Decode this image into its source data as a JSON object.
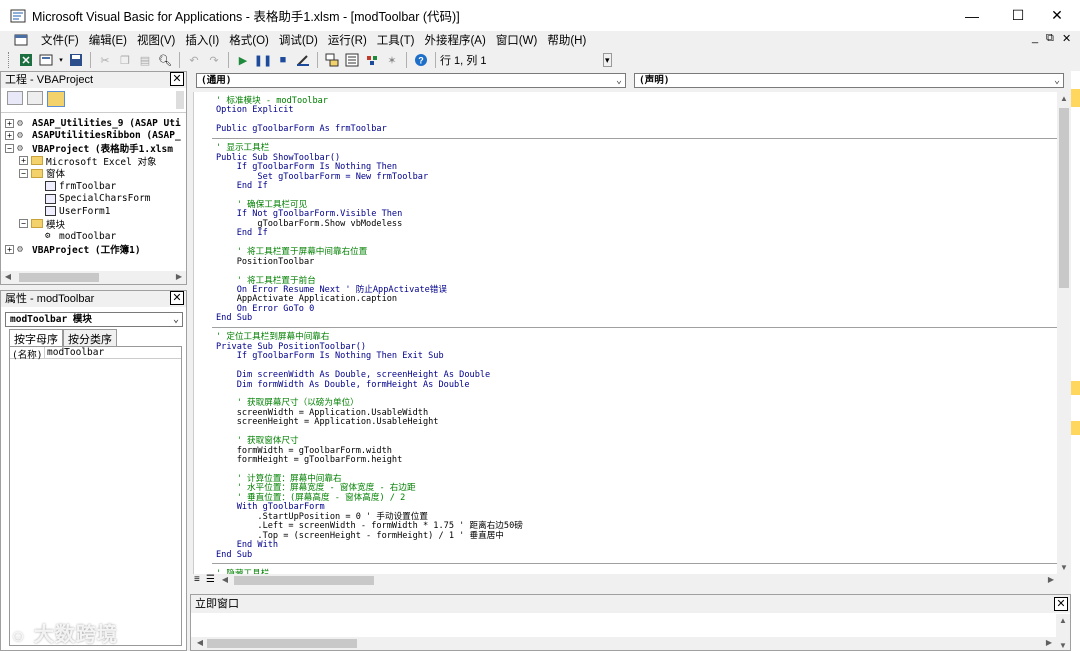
{
  "window": {
    "title": "Microsoft Visual Basic for Applications - 表格助手1.xlsm - [modToolbar (代码)]",
    "minimize": "—",
    "maximize": "☐",
    "close": "✕"
  },
  "menu": {
    "items": [
      "文件(F)",
      "编辑(E)",
      "视图(V)",
      "插入(I)",
      "格式(O)",
      "调试(D)",
      "运行(R)",
      "工具(T)",
      "外接程序(A)",
      "窗口(W)",
      "帮助(H)"
    ],
    "mdi_minimize": "_",
    "mdi_restore": "⧉",
    "mdi_close": "✕"
  },
  "toolbar": {
    "position_text": "行 1, 列 1",
    "icons": [
      "excel-icon",
      "insert-module-icon",
      "save-icon",
      "cut-icon",
      "copy-icon",
      "paste-icon",
      "find-icon",
      "undo-icon",
      "redo-icon",
      "run-icon",
      "break-icon",
      "reset-icon",
      "design-mode-icon",
      "project-explorer-icon",
      "properties-icon",
      "object-browser-icon",
      "toolbox-icon",
      "help-icon"
    ]
  },
  "project": {
    "header": "工程 - VBAProject",
    "close": "✕",
    "tree": [
      {
        "exp": "+",
        "icon": "vbp",
        "text": "ASAP_Utilities_9 (ASAP Uti",
        "bold": true,
        "indent": 0
      },
      {
        "exp": "+",
        "icon": "vbp",
        "text": "ASAPUtilitiesRibbon (ASAP_",
        "bold": true,
        "indent": 0
      },
      {
        "exp": "−",
        "icon": "vbp",
        "text": "VBAProject (表格助手1.xlsm",
        "bold": true,
        "indent": 0
      },
      {
        "exp": "+",
        "icon": "folder",
        "text": "Microsoft Excel 对象",
        "bold": false,
        "indent": 1
      },
      {
        "exp": "−",
        "icon": "folder",
        "text": "窗体",
        "bold": false,
        "indent": 1
      },
      {
        "exp": "",
        "icon": "form",
        "text": "frmToolbar",
        "bold": false,
        "indent": 2
      },
      {
        "exp": "",
        "icon": "form",
        "text": "SpecialCharsForm",
        "bold": false,
        "indent": 2
      },
      {
        "exp": "",
        "icon": "form",
        "text": "UserForm1",
        "bold": false,
        "indent": 2
      },
      {
        "exp": "−",
        "icon": "folder",
        "text": "模块",
        "bold": false,
        "indent": 1
      },
      {
        "exp": "",
        "icon": "module",
        "text": "modToolbar",
        "bold": false,
        "indent": 2
      },
      {
        "exp": "+",
        "icon": "vbp",
        "text": "VBAProject (工作簿1)",
        "bold": true,
        "indent": 0
      }
    ]
  },
  "properties": {
    "header": "属性 - modToolbar",
    "close": "✕",
    "object_combo": "modToolbar 模块",
    "tab_alpha": "按字母序",
    "tab_category": "按分类序",
    "prop_name": "(名称)",
    "prop_value": "modToolbar"
  },
  "code": {
    "object_combo": "(通用)",
    "proc_combo": "(声明)",
    "lines": [
      {
        "t": "' 标准模块 - modToolbar",
        "c": "cm"
      },
      {
        "t": "Option Explicit",
        "c": "kw"
      },
      {
        "t": "",
        "c": ""
      },
      {
        "t": "Public gToolbarForm As frmToolbar",
        "c": "kw"
      },
      {
        "t": "",
        "c": "sep"
      },
      {
        "t": "' 显示工具栏",
        "c": "cm"
      },
      {
        "t": "Public Sub ShowToolbar()",
        "c": "kw"
      },
      {
        "t": "    If gToolbarForm Is Nothing Then",
        "c": "kw"
      },
      {
        "t": "        Set gToolbarForm = New frmToolbar",
        "c": "kw"
      },
      {
        "t": "    End If",
        "c": "kw"
      },
      {
        "t": "",
        "c": ""
      },
      {
        "t": "    ' 确保工具栏可见",
        "c": "cm"
      },
      {
        "t": "    If Not gToolbarForm.Visible Then",
        "c": "kw"
      },
      {
        "t": "        gToolbarForm.Show vbModeless",
        "c": ""
      },
      {
        "t": "    End If",
        "c": "kw"
      },
      {
        "t": "",
        "c": ""
      },
      {
        "t": "    ' 将工具栏置于屏幕中间靠右位置",
        "c": "cm"
      },
      {
        "t": "    PositionToolbar",
        "c": ""
      },
      {
        "t": "",
        "c": ""
      },
      {
        "t": "    ' 将工具栏置于前台",
        "c": "cm"
      },
      {
        "t": "    On Error Resume Next ' 防止AppActivate错误",
        "c": "kw"
      },
      {
        "t": "    AppActivate Application.caption",
        "c": ""
      },
      {
        "t": "    On Error GoTo 0",
        "c": "kw"
      },
      {
        "t": "End Sub",
        "c": "kw"
      },
      {
        "t": "",
        "c": "sep"
      },
      {
        "t": "' 定位工具栏到屏幕中间靠右",
        "c": "cm"
      },
      {
        "t": "Private Sub PositionToolbar()",
        "c": "kw"
      },
      {
        "t": "    If gToolbarForm Is Nothing Then Exit Sub",
        "c": "kw"
      },
      {
        "t": "",
        "c": ""
      },
      {
        "t": "    Dim screenWidth As Double, screenHeight As Double",
        "c": "kw"
      },
      {
        "t": "    Dim formWidth As Double, formHeight As Double",
        "c": "kw"
      },
      {
        "t": "",
        "c": ""
      },
      {
        "t": "    ' 获取屏幕尺寸（以磅为单位）",
        "c": "cm"
      },
      {
        "t": "    screenWidth = Application.UsableWidth",
        "c": ""
      },
      {
        "t": "    screenHeight = Application.UsableHeight",
        "c": ""
      },
      {
        "t": "",
        "c": ""
      },
      {
        "t": "    ' 获取窗体尺寸",
        "c": "cm"
      },
      {
        "t": "    formWidth = gToolbarForm.width",
        "c": ""
      },
      {
        "t": "    formHeight = gToolbarForm.height",
        "c": ""
      },
      {
        "t": "",
        "c": ""
      },
      {
        "t": "    ' 计算位置：屏幕中间靠右",
        "c": "cm"
      },
      {
        "t": "    ' 水平位置：屏幕宽度 - 窗体宽度 - 右边距",
        "c": "cm"
      },
      {
        "t": "    ' 垂直位置：(屏幕高度 - 窗体高度) / 2",
        "c": "cm"
      },
      {
        "t": "    With gToolbarForm",
        "c": "kw"
      },
      {
        "t": "        .StartUpPosition = 0 ' 手动设置位置",
        "c": ""
      },
      {
        "t": "        .Left = screenWidth - formWidth * 1.75 ' 距离右边50磅",
        "c": ""
      },
      {
        "t": "        .Top = (screenHeight - formHeight) / 1 ' 垂直居中",
        "c": ""
      },
      {
        "t": "    End With",
        "c": "kw"
      },
      {
        "t": "End Sub",
        "c": "kw"
      },
      {
        "t": "",
        "c": "sep"
      },
      {
        "t": "' 隐藏工具栏",
        "c": "cm"
      }
    ]
  },
  "immediate": {
    "header": "立即窗口",
    "close": "✕"
  },
  "watermark": "大数跨境"
}
